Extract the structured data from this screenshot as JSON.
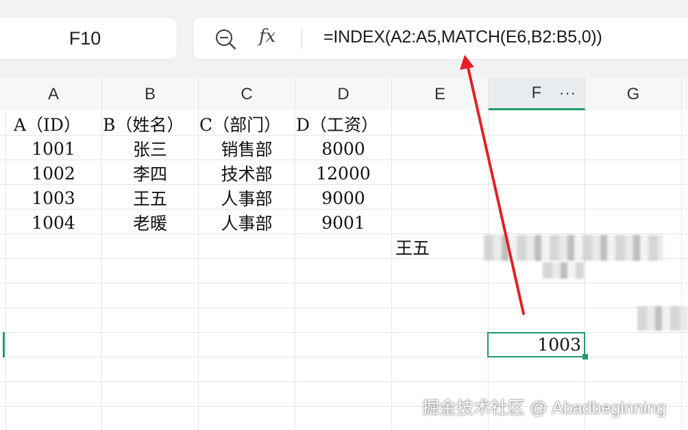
{
  "name_box": {
    "value": "F10"
  },
  "formula_bar": {
    "zoom_icon": "zoom-out-icon",
    "fx_label": "fx",
    "formula": "=INDEX(A2:A5,MATCH(E6,B2:B5,0))"
  },
  "columns": {
    "a": "A",
    "b": "B",
    "c": "C",
    "d": "D",
    "e": "E",
    "f": "F",
    "g": "G",
    "more": "···"
  },
  "table": {
    "headers": [
      "A（ID）",
      "B（姓名）",
      "C（部门）",
      "D（工资）"
    ],
    "rows": [
      [
        "1001",
        "张三",
        "销售部",
        "8000"
      ],
      [
        "1002",
        "李四",
        "技术部",
        "12000"
      ],
      [
        "1003",
        "王五",
        "人事部",
        "9000"
      ],
      [
        "1004",
        "老暖",
        "人事部",
        "9001"
      ]
    ]
  },
  "lookup_value": "王五",
  "result_value": "1003",
  "watermark": "掘金技术社区 @ Abadbeginning",
  "colors": {
    "accent": "#1d9b6a",
    "arrow": "#e32026"
  }
}
